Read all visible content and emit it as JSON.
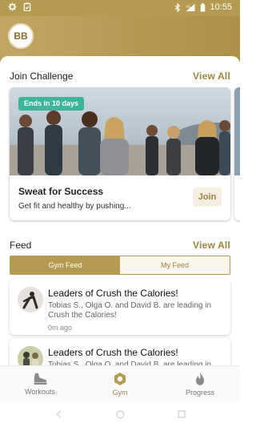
{
  "status_bar": {
    "time": "10:55",
    "icons": [
      "gear-icon",
      "clipboard-icon",
      "bluetooth-icon",
      "signal-4g-icon",
      "battery-icon"
    ]
  },
  "header": {
    "avatar_initials": "BB"
  },
  "join_challenge": {
    "title": "Join Challenge",
    "view_all": "View All",
    "card": {
      "badge": "Ends in 10 days",
      "title": "Sweat for Success",
      "description": "Get fit and healthy by pushing...",
      "join_label": "Join"
    }
  },
  "feed": {
    "title": "Feed",
    "view_all": "View All",
    "tabs": [
      {
        "label": "Gym Feed",
        "active": true
      },
      {
        "label": "My Feed",
        "active": false
      }
    ],
    "items": [
      {
        "title": "Leaders of Crush the Calories!",
        "text": "Tobias S., Olga O. and David B. are leading in Crush the Calories!",
        "time": "0m ago"
      },
      {
        "title": "Leaders of Crush the Calories!",
        "text": "Tobias S., Olga O. and David B. are leading in Crush the Calories!",
        "time": ""
      }
    ]
  },
  "bottom_nav": {
    "items": [
      {
        "label": "Workouts",
        "icon": "shoe-icon",
        "active": false
      },
      {
        "label": "Gym",
        "icon": "gym-icon",
        "active": true
      },
      {
        "label": "Progress",
        "icon": "flame-icon",
        "active": false
      }
    ]
  },
  "colors": {
    "accent": "#b59a52",
    "badge": "#3db59b"
  }
}
